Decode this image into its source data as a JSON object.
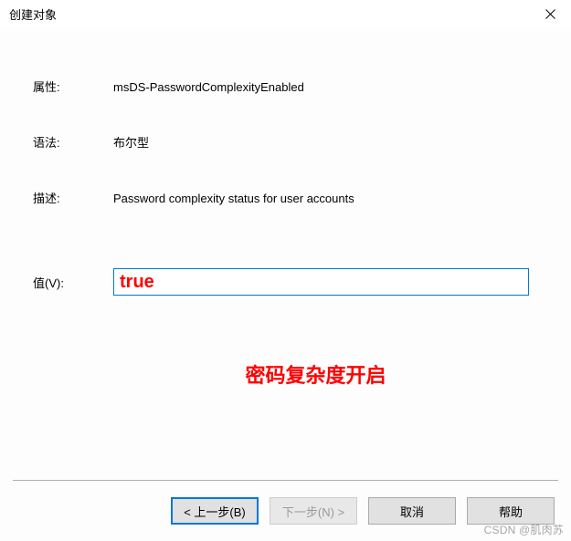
{
  "window": {
    "title": "创建对象"
  },
  "fields": {
    "attribute": {
      "label": "属性:",
      "value": "msDS-PasswordComplexityEnabled"
    },
    "syntax": {
      "label": "语法:",
      "value": "布尔型"
    },
    "description": {
      "label": "描述:",
      "value": "Password complexity status for user accounts"
    },
    "value_field": {
      "label": "值(V):",
      "value": "true"
    }
  },
  "annotation": "密码复杂度开启",
  "buttons": {
    "back": "< 上一步(B)",
    "next": "下一步(N) >",
    "cancel": "取消",
    "help": "帮助"
  },
  "watermark": "CSDN @肌肉苏"
}
